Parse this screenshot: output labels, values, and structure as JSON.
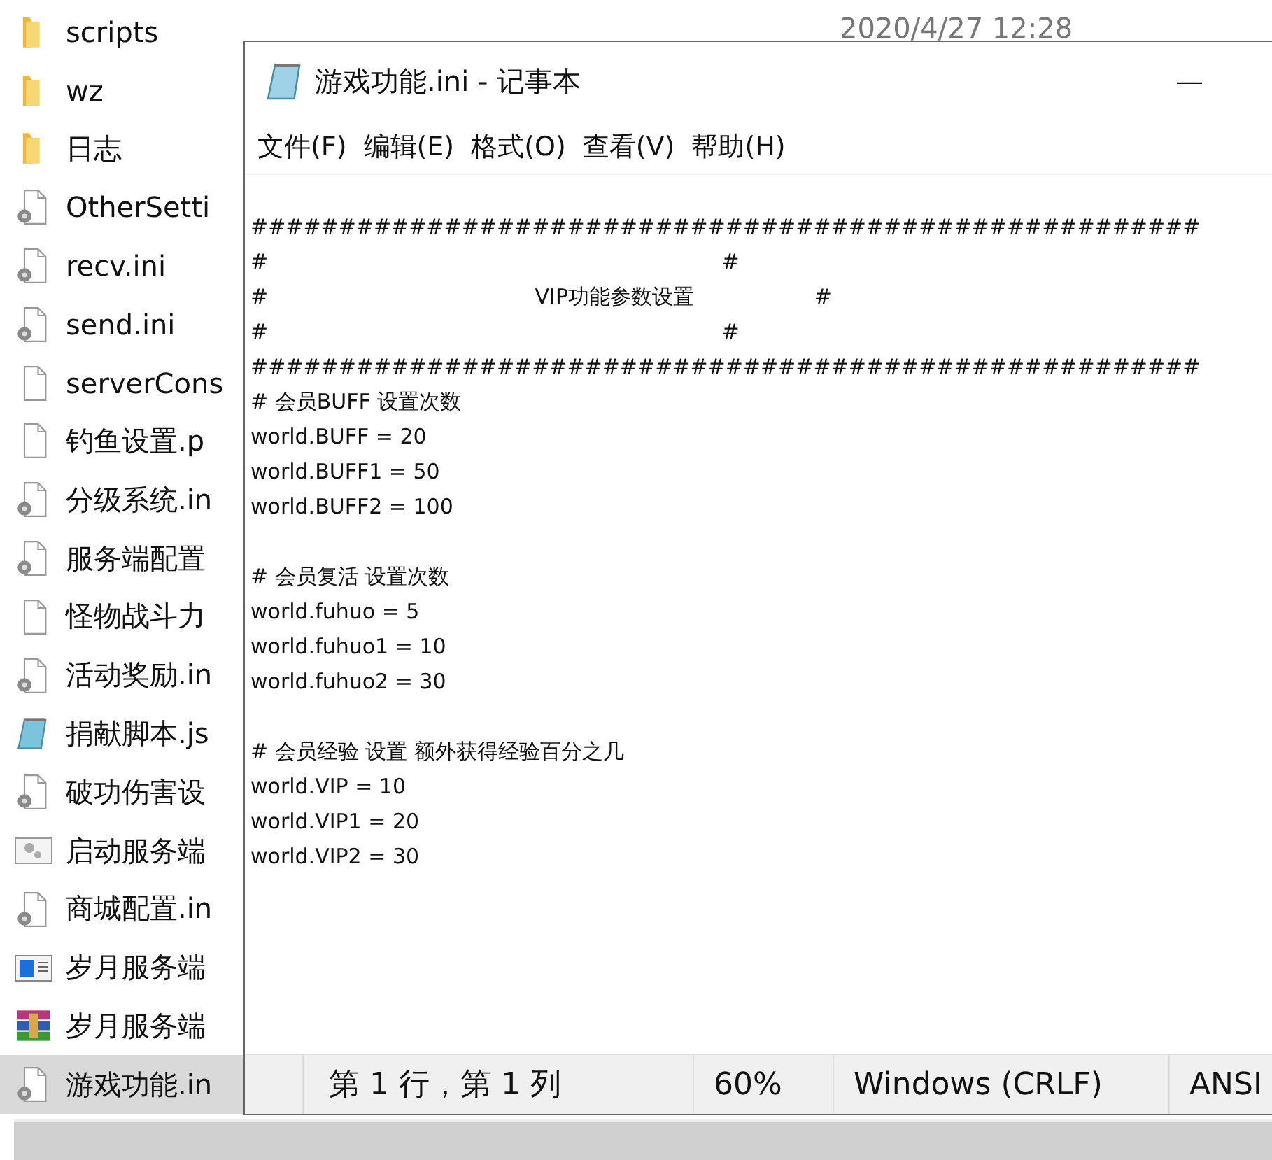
{
  "file_list": {
    "items": [
      {
        "name": "scripts",
        "kind": "folder",
        "selected": false
      },
      {
        "name": "wz",
        "kind": "folder",
        "selected": false
      },
      {
        "name": "日志",
        "kind": "folder",
        "selected": false
      },
      {
        "name": "OtherSetti",
        "kind": "settings",
        "selected": false
      },
      {
        "name": "recv.ini",
        "kind": "settings",
        "selected": false
      },
      {
        "name": "send.ini",
        "kind": "settings",
        "selected": false
      },
      {
        "name": "serverCons",
        "kind": "file",
        "selected": false
      },
      {
        "name": "钓鱼设置.p",
        "kind": "file",
        "selected": false
      },
      {
        "name": "分级系统.in",
        "kind": "settings",
        "selected": false
      },
      {
        "name": "服务端配置",
        "kind": "settings",
        "selected": false
      },
      {
        "name": "怪物战斗力",
        "kind": "file",
        "selected": false
      },
      {
        "name": "活动奖励.in",
        "kind": "settings",
        "selected": false
      },
      {
        "name": "捐献脚本.js",
        "kind": "notepad",
        "selected": false
      },
      {
        "name": "破功伤害设",
        "kind": "settings",
        "selected": false
      },
      {
        "name": "启动服务端",
        "kind": "batch",
        "selected": false
      },
      {
        "name": "商城配置.in",
        "kind": "settings",
        "selected": false
      },
      {
        "name": "岁月服务端",
        "kind": "app",
        "selected": false
      },
      {
        "name": "岁月服务端",
        "kind": "archive",
        "selected": false
      },
      {
        "name": "游戏功能.in",
        "kind": "settings",
        "selected": true
      }
    ],
    "date": "2020/4/27 12:28"
  },
  "notepad": {
    "title": "游戏功能.ini - 记事本",
    "minimize": "—",
    "menu": [
      "文件(F)",
      "编辑(E)",
      "格式(O)",
      "查看(V)",
      "帮助(H)"
    ],
    "text": "######################################################\n#                                                                    #\n#                                        VIP功能参数设置                  #\n#                                                                    #\n######################################################\n# 会员BUFF 设置次数\nworld.BUFF = 20\nworld.BUFF1 = 50\nworld.BUFF2 = 100\n\n# 会员复活 设置次数\nworld.fuhuo = 5\nworld.fuhuo1 = 10\nworld.fuhuo2 = 30\n\n# 会员经验 设置 额外获得经验百分之几\nworld.VIP = 10\nworld.VIP1 = 20\nworld.VIP2 = 30",
    "status": [
      "第 1 行，第 1 列",
      "60%",
      "Windows (CRLF)",
      "ANSI"
    ]
  }
}
